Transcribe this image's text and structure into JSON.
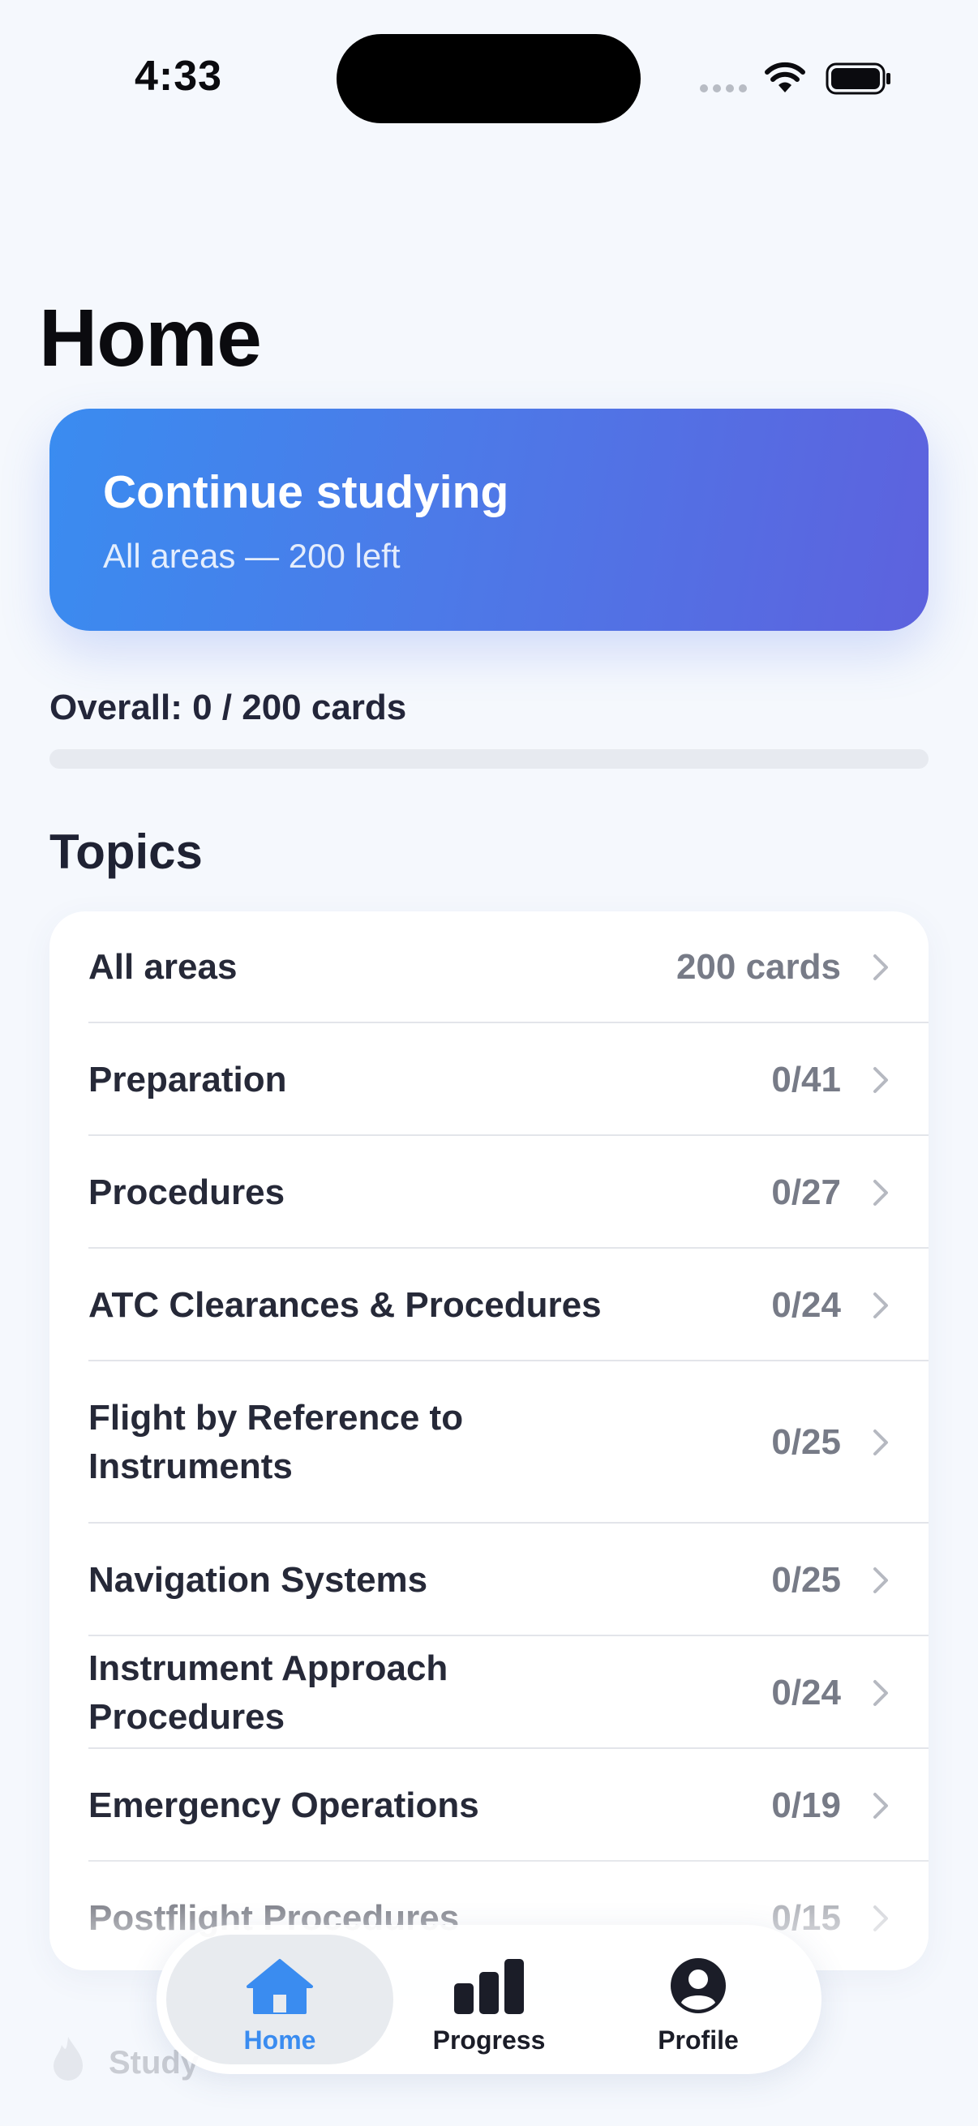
{
  "status_bar": {
    "time": "4:33"
  },
  "page": {
    "title": "Home"
  },
  "continue_card": {
    "title": "Continue studying",
    "subtitle": "All areas — 200 left"
  },
  "overall": {
    "label": "Overall: 0 / 200 cards",
    "progress_fraction": 0
  },
  "topics": {
    "title": "Topics",
    "items": [
      {
        "label": "All areas",
        "count": "200 cards"
      },
      {
        "label": "Preparation",
        "count": "0/41"
      },
      {
        "label": "Procedures",
        "count": "0/27"
      },
      {
        "label": "ATC Clearances & Procedures",
        "count": "0/24"
      },
      {
        "label": "Flight by Reference to Instruments",
        "count": "0/25"
      },
      {
        "label": "Navigation Systems",
        "count": "0/25"
      },
      {
        "label": "Instrument Approach Procedures",
        "count": "0/24"
      },
      {
        "label": "Emergency Operations",
        "count": "0/19"
      },
      {
        "label": "Postflight Procedures",
        "count": "0/15"
      }
    ]
  },
  "behind_tabbar": {
    "label": "Study"
  },
  "tab_bar": {
    "active": "home",
    "tabs": [
      {
        "id": "home",
        "label": "Home",
        "icon": "house-icon"
      },
      {
        "id": "progress",
        "label": "Progress",
        "icon": "bar-chart-icon"
      },
      {
        "id": "profile",
        "label": "Profile",
        "icon": "person-circle-icon"
      }
    ]
  },
  "colors": {
    "accent": "#3a8cf0",
    "gradient_start": "#3a8cf0",
    "gradient_end": "#5d62de",
    "background": "#f5f8fd"
  }
}
